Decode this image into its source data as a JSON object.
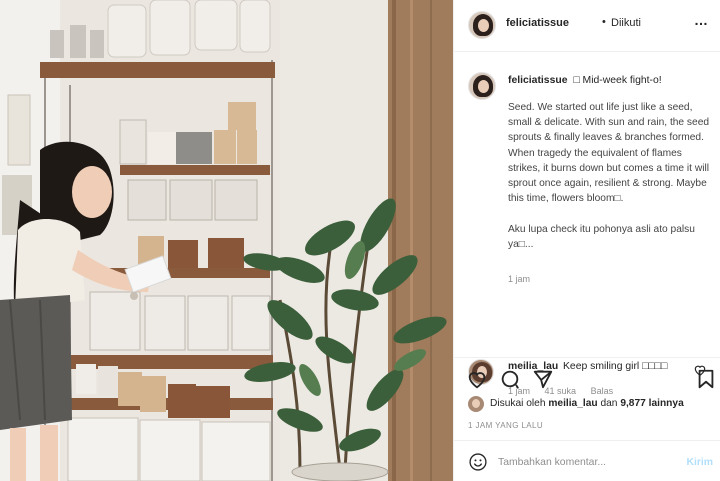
{
  "header": {
    "username": "feliciatissue",
    "dot": "•",
    "follow_status": "Diikuti",
    "more": "…"
  },
  "post": {
    "username": "feliciatissue",
    "title": "□ Mid-week fight-o!",
    "body": "Seed. We started out life just like a seed, small & delicate. With sun and rain, the seed sprouts & finally leaves & branches formed. When tragedy the equivalent of flames strikes, it burns down but comes a time it will sprout once again, resilient & strong. Maybe this time, flowers bloom□.\n\nAku lupa check itu pohonya asli ato palsu ya□...",
    "time": "1 jam"
  },
  "comment": {
    "username": "meilia_lau",
    "text": "Keep smiling girl □□□□",
    "time": "1 jam",
    "likes": "41 suka",
    "reply": "Balas"
  },
  "likes": {
    "prefix": "Disukai oleh",
    "user": "meilia_lau",
    "and": "dan",
    "count": "9,877 lainnya"
  },
  "time_ago": "1 JAM YANG LALU",
  "add_comment": {
    "placeholder": "Tambahkan komentar...",
    "post_label": "Kirim"
  },
  "icons": {
    "like": "heart-icon",
    "comment": "comment-icon",
    "share": "share-icon",
    "save": "bookmark-icon",
    "emoji": "smile-icon",
    "more": "more-icon"
  },
  "colors": {
    "text": "#262626",
    "muted": "#8e8e8e",
    "border": "#efefef",
    "post_button": "#b2dffc"
  }
}
